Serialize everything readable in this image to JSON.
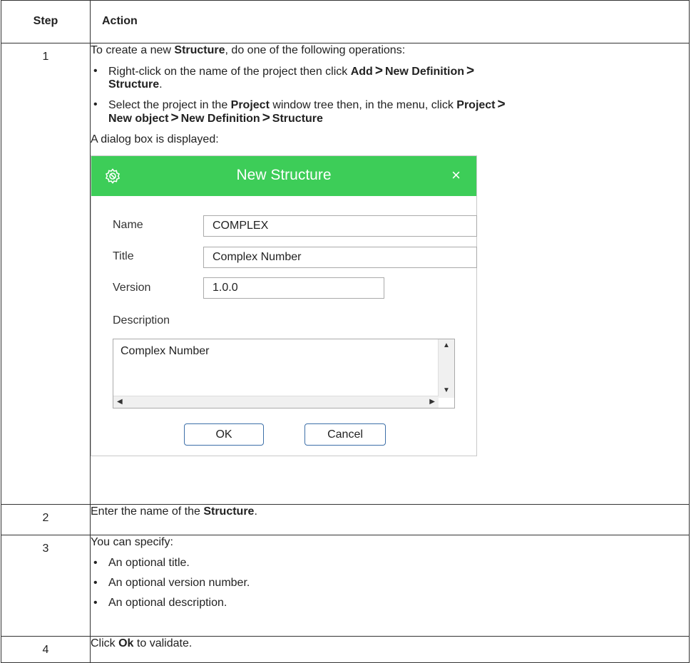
{
  "table": {
    "header": {
      "step": "Step",
      "action": "Action"
    },
    "row1": {
      "step": "1",
      "intro": {
        "pre": "To create a new ",
        "bold": "Structure",
        "post": ", do one of the following operations:"
      },
      "bullet1": {
        "pre": "Right-click on the name of the project then click ",
        "b1": "Add",
        "b2": "New Definition",
        "b3": "Structure",
        "post": "."
      },
      "bullet2": {
        "pre": "Select the project in the ",
        "b1": "Project",
        "mid": " window tree then, in the menu, click ",
        "b2": "Project",
        "b3": "New object",
        "b4": "New Definition",
        "b5": "Structure"
      },
      "gt": ">",
      "dialog_intro": "A dialog box is displayed:"
    },
    "row2": {
      "step": "2",
      "pre": "Enter the name of the ",
      "bold": "Structure",
      "post": "."
    },
    "row3": {
      "step": "3",
      "intro": "You can specify:",
      "items": [
        "An optional title.",
        "An optional version number.",
        "An optional description."
      ]
    },
    "row4": {
      "step": "4",
      "pre": "Click ",
      "bold": "Ok",
      "post": " to validate."
    }
  },
  "dialog": {
    "title": "New Structure",
    "close": "×",
    "fields": {
      "name_label": "Name",
      "name_value": "COMPLEX",
      "title_label": "Title",
      "title_value": "Complex Number",
      "version_label": "Version",
      "version_value": "1.0.0",
      "description_label": "Description",
      "description_value": "Complex Number"
    },
    "ok": "OK",
    "cancel": "Cancel",
    "accent": "#3dcd58"
  }
}
